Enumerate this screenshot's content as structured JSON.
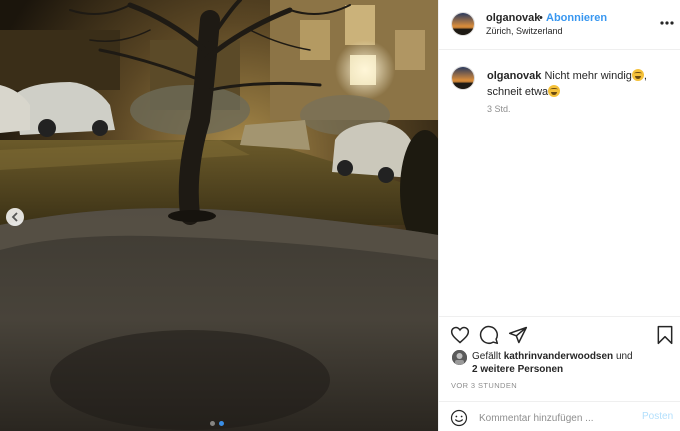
{
  "post": {
    "user": "olganovak",
    "separator": "•",
    "follow_label": "Abonnieren",
    "location": "Zürich, Switzerland",
    "more_icon": "more-options-icon"
  },
  "caption": {
    "user": "olganovak",
    "line1": "Nicht mehr windig",
    "line2": "schneit etwa",
    "emoji": "laughing-tears-emoji",
    "time": "3 Std."
  },
  "actions": {
    "icons": [
      "heart-icon",
      "comment-icon",
      "share-icon",
      "bookmark-icon"
    ]
  },
  "likes": {
    "prefix": "Gefällt",
    "liker": "kathrinvanderwoodsen",
    "conj": "und",
    "others": "2 weitere Personen"
  },
  "timestamp": "VOR 3 STUNDEN",
  "comment_box": {
    "placeholder": "Kommentar hinzufügen ...",
    "post_label": "Posten"
  },
  "carousel": {
    "slide_count": 2,
    "active_slide": 2
  },
  "colors": {
    "accent": "#3897f0",
    "post_disabled": "#b2dffc",
    "muted": "#8e8e8e"
  }
}
